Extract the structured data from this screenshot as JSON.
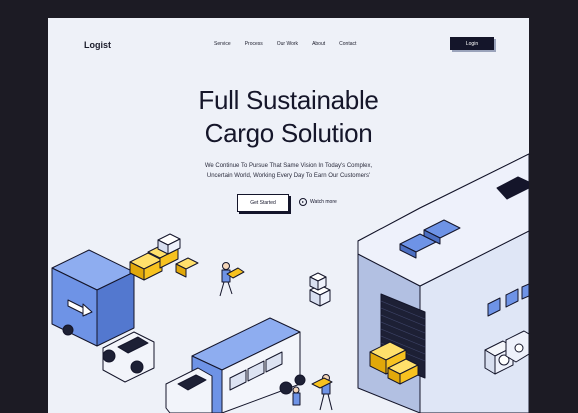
{
  "header": {
    "logo": "Logist",
    "nav": [
      "Service",
      "Process",
      "Our Work",
      "About",
      "Contact"
    ],
    "login_label": "Login"
  },
  "hero": {
    "title_line1": "Full Sustainable",
    "title_line2": "Cargo Solution",
    "subtitle_line1": "We Continue To Pursue That Same Vision In Today's Complex,",
    "subtitle_line2": "Uncertain World, Working Every Day To Earn Our Customers'",
    "cta_label": "Get Started",
    "watch_label": "Watch more"
  },
  "colors": {
    "page_bg": "#1c1b24",
    "frame_bg": "#eef1f8",
    "accent_blue": "#6e93e6",
    "accent_yellow": "#f7c21f",
    "ink": "#14152a"
  },
  "icons": [
    "play-icon",
    "arrow-right-icon"
  ]
}
